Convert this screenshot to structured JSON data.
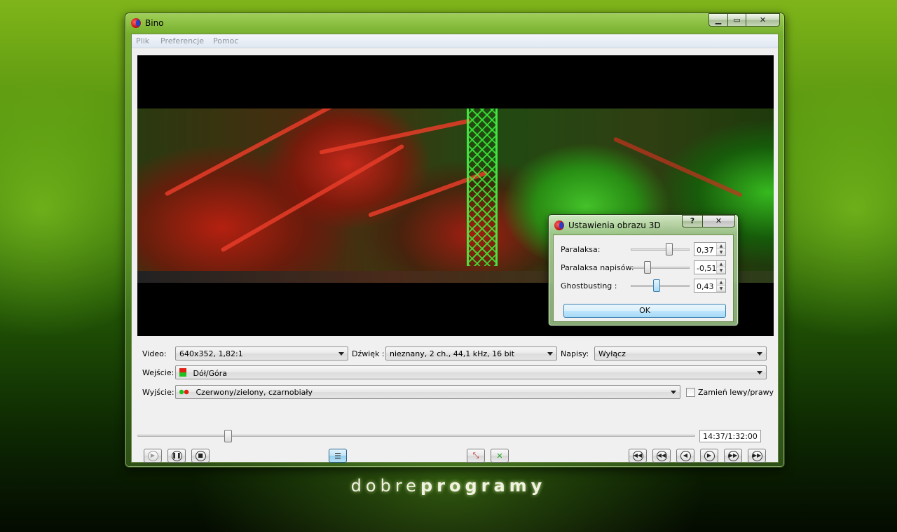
{
  "window": {
    "title": "Bino",
    "min_label": "▁",
    "max_label": "▭",
    "close_label": "✕"
  },
  "menu": [
    "Plik",
    "Preferencje",
    "Pomoc"
  ],
  "controls": {
    "video_label": "Video:",
    "video_value": "640x352, 1,82:1",
    "audio_label": "Dźwięk :",
    "audio_value": "nieznany, 2 ch., 44,1 kHz, 16 bit",
    "subs_label": "Napisy:",
    "subs_value": "Wyłącz",
    "input_label": "Wejście:",
    "input_value": "Dół/Góra",
    "output_label": "Wyjście:",
    "output_value": "Czerwony/zielony, czarnobiały",
    "swap_label": "Zamień lewy/prawy",
    "time": "14:37/1:32:00",
    "seek_progress": 0.158
  },
  "transport_icons": [
    "play-icon",
    "pause-icon",
    "stop-icon",
    "playlist-icon",
    "fullscreen-icon",
    "center-icon",
    "seek-back-10min-icon",
    "seek-back-1min-icon",
    "seek-back-10s-icon",
    "seek-fwd-10s-icon",
    "seek-fwd-1min-icon",
    "seek-fwd-10min-icon"
  ],
  "dialog": {
    "title": "Ustawienia obrazu 3D",
    "help_label": "?",
    "close_label": "✕",
    "rows": [
      {
        "label": "Paralaksa:",
        "value": "0,37",
        "level": 0.67
      },
      {
        "label": "Paralaksa napisów:",
        "value": "-0,51",
        "level": 0.26
      },
      {
        "label": "Ghostbusting :",
        "value": "0,43",
        "level": 0.43
      }
    ],
    "ok_label": "OK"
  },
  "brand": {
    "light": "dobre",
    "bold": "programy"
  },
  "colors": {
    "accent_green": "#7fb51a",
    "menu_text": "#8b94a0"
  }
}
